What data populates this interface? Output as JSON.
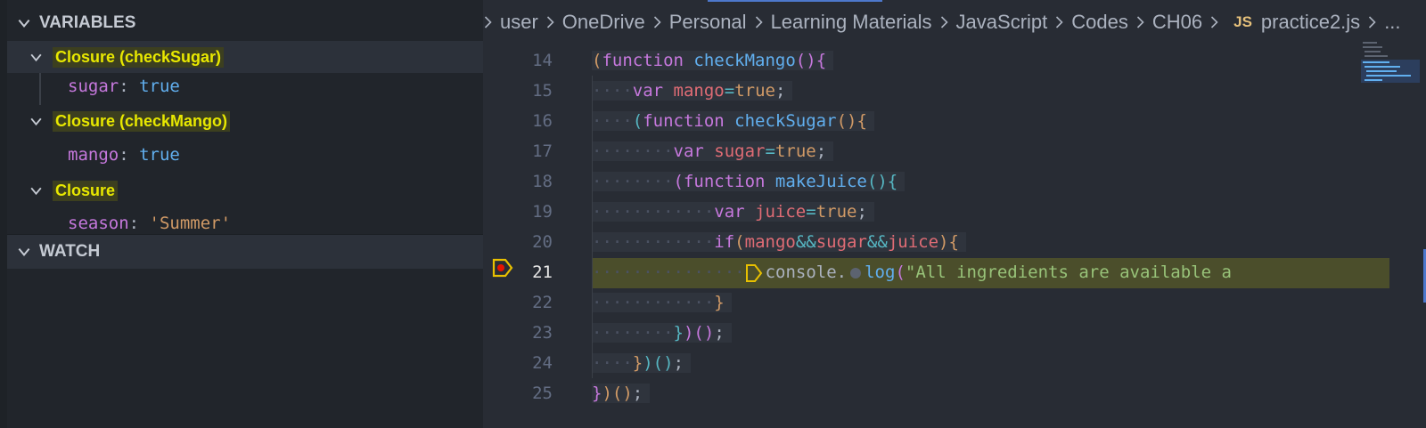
{
  "variables": {
    "header": "VARIABLES",
    "scopes": [
      {
        "label": "Closure (checkSugar)",
        "vars": [
          {
            "name": "sugar",
            "sep": ": ",
            "value": "true",
            "kind": "bool"
          }
        ]
      },
      {
        "label": "Closure (checkMango)",
        "vars": [
          {
            "name": "mango",
            "sep": ": ",
            "value": "true",
            "kind": "bool"
          }
        ]
      },
      {
        "label": "Closure",
        "vars": [
          {
            "name": "season",
            "sep": ": ",
            "value": "'Summer'",
            "kind": "string"
          }
        ]
      }
    ]
  },
  "watch": {
    "header": "WATCH"
  },
  "breadcrumb": {
    "items": [
      "user",
      "OneDrive",
      "Personal",
      "Learning Materials",
      "JavaScript",
      "Codes",
      "CH06"
    ],
    "file_badge": "JS",
    "file": "practice2.js",
    "overflow": "..."
  },
  "editor": {
    "active_line": 21,
    "paused_line": 21,
    "lines": [
      {
        "num": "14",
        "indent": "",
        "code": [
          [
            "br1",
            "("
          ],
          [
            "kw",
            "function "
          ],
          [
            "fn",
            "checkMango"
          ],
          [
            "br2",
            "()"
          ],
          [
            "br2",
            "{"
          ]
        ]
      },
      {
        "num": "15",
        "indent": "····",
        "code": [
          [
            "kw",
            "var "
          ],
          [
            "vr",
            "mango"
          ],
          [
            "op",
            "="
          ],
          [
            "bool",
            "true"
          ],
          [
            "pn",
            ";"
          ]
        ]
      },
      {
        "num": "16",
        "indent": "····",
        "code": [
          [
            "br3",
            "("
          ],
          [
            "kw",
            "function "
          ],
          [
            "fn",
            "checkSugar"
          ],
          [
            "br1",
            "()"
          ],
          [
            "br1",
            "{"
          ]
        ]
      },
      {
        "num": "17",
        "indent": "········",
        "code": [
          [
            "kw",
            "var "
          ],
          [
            "vr",
            "sugar"
          ],
          [
            "op",
            "="
          ],
          [
            "bool",
            "true"
          ],
          [
            "pn",
            ";"
          ]
        ]
      },
      {
        "num": "18",
        "indent": "········",
        "code": [
          [
            "br2",
            "("
          ],
          [
            "kw",
            "function "
          ],
          [
            "fn",
            "makeJuice"
          ],
          [
            "br3",
            "()"
          ],
          [
            "br3",
            "{"
          ]
        ]
      },
      {
        "num": "19",
        "indent": "············",
        "code": [
          [
            "kw",
            "var "
          ],
          [
            "vr",
            "juice"
          ],
          [
            "op",
            "="
          ],
          [
            "bool",
            "true"
          ],
          [
            "pn",
            ";"
          ]
        ]
      },
      {
        "num": "20",
        "indent": "············",
        "code": [
          [
            "kw",
            "if"
          ],
          [
            "br1",
            "("
          ],
          [
            "vr",
            "mango"
          ],
          [
            "op",
            "&&"
          ],
          [
            "vr",
            "sugar"
          ],
          [
            "op",
            "&&"
          ],
          [
            "vr",
            "juice"
          ],
          [
            "br1",
            ")"
          ],
          [
            "br1",
            "{"
          ]
        ]
      },
      {
        "num": "21",
        "indent": "···············",
        "code": [
          [
            "pn",
            "console."
          ],
          [
            "fn",
            "log"
          ],
          [
            "br2",
            "("
          ],
          [
            "st",
            "\"All ingredients are available a"
          ]
        ]
      },
      {
        "num": "22",
        "indent": "············",
        "code": [
          [
            "br1",
            "}"
          ]
        ]
      },
      {
        "num": "23",
        "indent": "········",
        "code": [
          [
            "br3",
            "}"
          ],
          [
            "br2",
            ")"
          ],
          [
            "br2",
            "()"
          ],
          [
            "pn",
            ";"
          ]
        ]
      },
      {
        "num": "24",
        "indent": "····",
        "code": [
          [
            "br1",
            "}"
          ],
          [
            "br3",
            ")"
          ],
          [
            "br3",
            "()"
          ],
          [
            "pn",
            ";"
          ]
        ]
      },
      {
        "num": "25",
        "indent": "",
        "code": [
          [
            "br2",
            "}"
          ],
          [
            "br1",
            ")"
          ],
          [
            "br1",
            "()"
          ],
          [
            "pn",
            ";"
          ]
        ]
      }
    ]
  },
  "colors": {
    "accent": "#4d78cc",
    "scope_highlight": "#e8e800",
    "paused_line_bg": "#4b4e2b",
    "breakpoint": "#e8c000"
  }
}
